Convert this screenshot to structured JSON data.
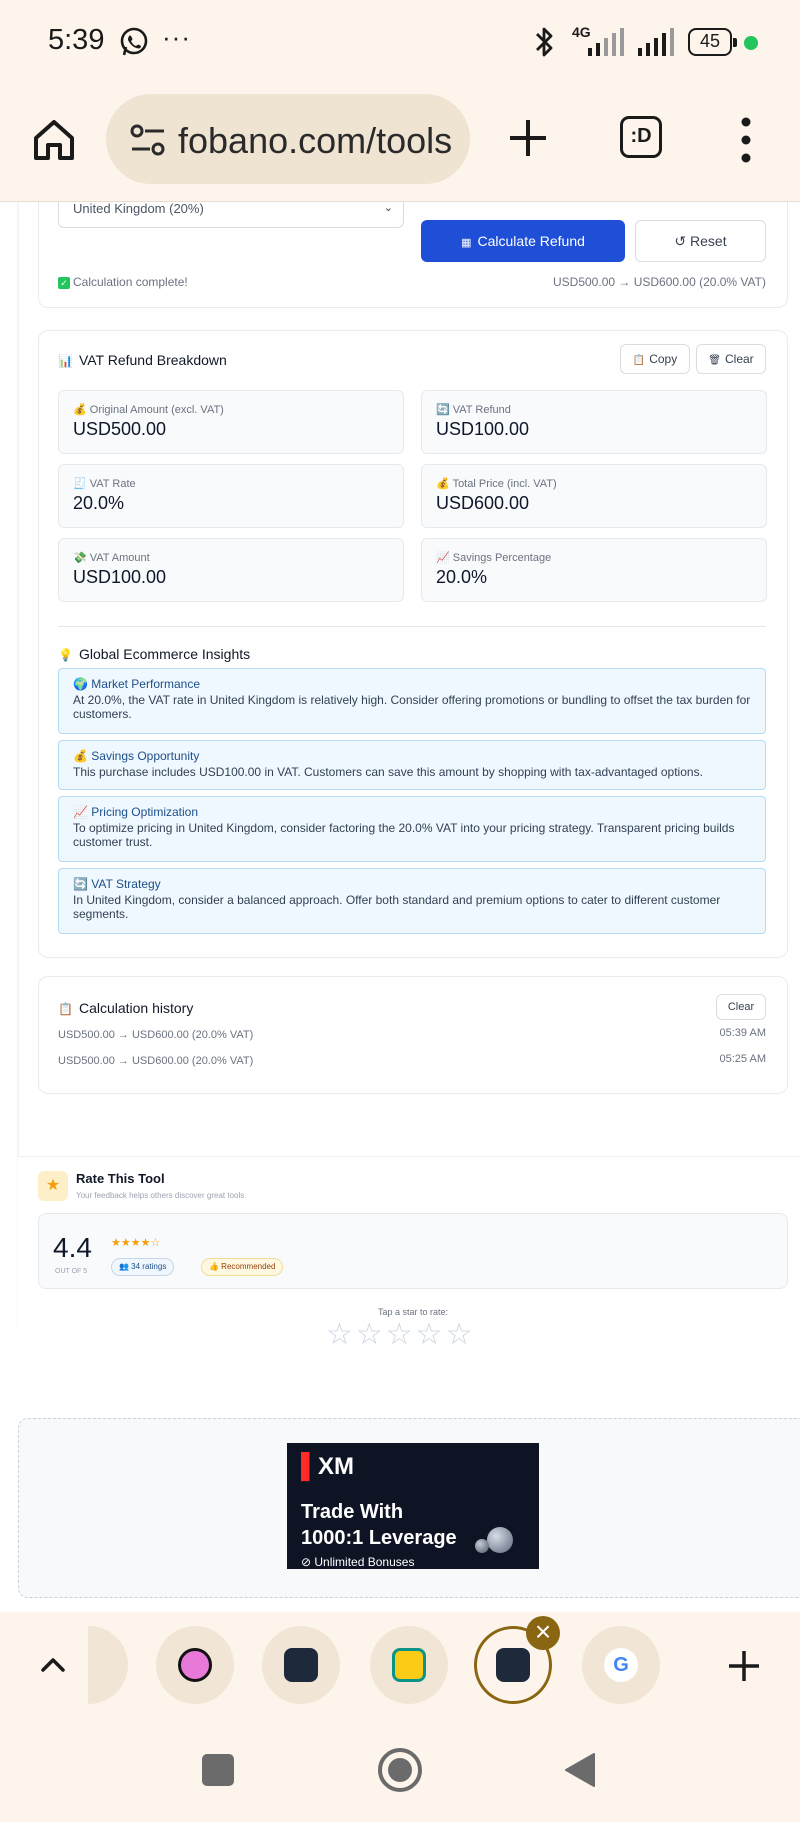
{
  "status_bar": {
    "time": "5:39",
    "ellipsis": "···",
    "network": "4G",
    "battery": "45"
  },
  "browser": {
    "url": "fobano.com/tools",
    "tabs_label": ":D"
  },
  "calculator": {
    "country_select": "United Kingdom (20%)",
    "calculate_label": "Calculate Refund",
    "reset_label": "↺ Reset",
    "status": "Calculation complete!",
    "summary": "USD500.00 → USD600.00 (20.0% VAT)"
  },
  "breakdown": {
    "title": "VAT Refund Breakdown",
    "copy_label": "Copy",
    "clear_label": "Clear",
    "stats": [
      {
        "label": "Original Amount (excl. VAT)",
        "value": "USD500.00",
        "icon": "💰"
      },
      {
        "label": "VAT Refund",
        "value": "USD100.00",
        "icon": "🔄"
      },
      {
        "label": "VAT Rate",
        "value": "20.0%",
        "icon": "🧾"
      },
      {
        "label": "Total Price (incl. VAT)",
        "value": "USD600.00",
        "icon": "💰"
      },
      {
        "label": "VAT Amount",
        "value": "USD100.00",
        "icon": "💸"
      },
      {
        "label": "Savings Percentage",
        "value": "20.0%",
        "icon": "📈"
      }
    ]
  },
  "insights": {
    "title": "Global Ecommerce Insights",
    "items": [
      {
        "icon": "🌍",
        "title": "Market Performance",
        "body": "At 20.0%, the VAT rate in United Kingdom is relatively high. Consider offering promotions or bundling to offset the tax burden for customers."
      },
      {
        "icon": "💰",
        "title": "Savings Opportunity",
        "body": "This purchase includes USD100.00 in VAT. Customers can save this amount by shopping with tax-advantaged options."
      },
      {
        "icon": "📈",
        "title": "Pricing Optimization",
        "body": "To optimize pricing in United Kingdom, consider factoring the 20.0% VAT into your pricing strategy. Transparent pricing builds customer trust."
      },
      {
        "icon": "🔄",
        "title": "VAT Strategy",
        "body": "In United Kingdom, consider a balanced approach. Offer both standard and premium options to cater to different customer segments."
      }
    ]
  },
  "history": {
    "title": "Calculation history",
    "clear_label": "Clear",
    "rows": [
      {
        "text": "USD500.00 → USD600.00 (20.0% VAT)",
        "time": "05:39 AM"
      },
      {
        "text": "USD500.00 → USD600.00 (20.0% VAT)",
        "time": "05:25 AM"
      }
    ]
  },
  "rating": {
    "title": "Rate This Tool",
    "subtitle": "Your feedback helps others discover great tools",
    "score": "4.4",
    "out_of": "OUT OF 5",
    "stars": "★★★★☆",
    "count": "👥 34 ratings",
    "badge": "👍 Recommended",
    "tap_label": "Tap a star to rate:",
    "tap_stars": "☆☆☆☆☆"
  },
  "ad": {
    "brand": "XM",
    "line1": "Trade With",
    "line2": "1000:1 Leverage",
    "line3": "⊘ Unlimited Bonuses"
  },
  "colors": {
    "accent": "#1e4fd6",
    "browser_chrome": "#fdf5eb",
    "insight_bg": "#eff8fe",
    "active_tab": "#8a6512"
  }
}
